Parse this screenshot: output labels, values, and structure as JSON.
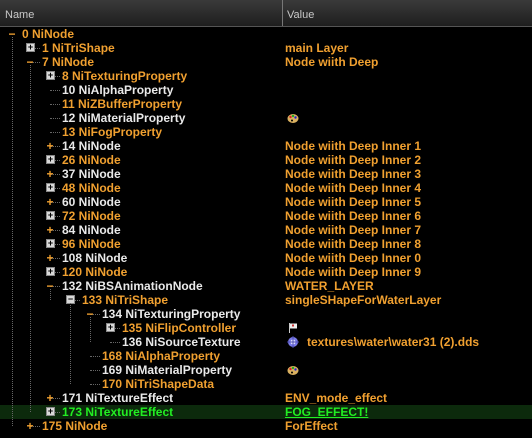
{
  "header": {
    "col_name": "Name",
    "col_value": "Value"
  },
  "rows": [
    {
      "name": "0 NiNode",
      "value": "",
      "expander": "minus",
      "style": "orange"
    },
    {
      "name": "1 NiTriShape",
      "value": "main Layer",
      "expander": "plus-box",
      "style": "orange"
    },
    {
      "name": "7 NiNode",
      "value": "Node wiith Deep",
      "expander": "minus",
      "style": "orange"
    },
    {
      "name": "8 NiTexturingProperty",
      "value": "",
      "expander": "plus-box",
      "style": "orange"
    },
    {
      "name": "10 NiAlphaProperty",
      "value": "",
      "expander": "none",
      "style": "white"
    },
    {
      "name": "11 NiZBufferProperty",
      "value": "",
      "expander": "none",
      "style": "orange"
    },
    {
      "name": "12 NiMaterialProperty",
      "value": "",
      "expander": "none",
      "style": "white",
      "value_icon": "palette-icon"
    },
    {
      "name": "13 NiFogProperty",
      "value": "",
      "expander": "none",
      "style": "orange"
    },
    {
      "name": "14 NiNode",
      "value": "Node wiith Deep Inner 1",
      "expander": "plus",
      "style": "white"
    },
    {
      "name": "26 NiNode",
      "value": "Node wiith Deep Inner 2",
      "expander": "plus-box",
      "style": "orange"
    },
    {
      "name": "37 NiNode",
      "value": "Node wiith Deep Inner 3",
      "expander": "plus",
      "style": "white"
    },
    {
      "name": "48 NiNode",
      "value": "Node wiith Deep Inner 4",
      "expander": "plus-box",
      "style": "orange"
    },
    {
      "name": "60 NiNode",
      "value": "Node wiith Deep Inner 5",
      "expander": "plus",
      "style": "white"
    },
    {
      "name": "72 NiNode",
      "value": "Node wiith Deep Inner 6",
      "expander": "plus-box",
      "style": "orange"
    },
    {
      "name": "84 NiNode",
      "value": "Node wiith Deep Inner 7",
      "expander": "plus",
      "style": "white"
    },
    {
      "name": "96 NiNode",
      "value": "Node wiith Deep Inner 8",
      "expander": "plus-box",
      "style": "orange"
    },
    {
      "name": "108 NiNode",
      "value": "Node wiith Deep Inner 0",
      "expander": "plus",
      "style": "white"
    },
    {
      "name": "120 NiNode",
      "value": "Node wiith Deep Inner 9",
      "expander": "plus-box",
      "style": "orange"
    },
    {
      "name": "132 NiBSAnimationNode",
      "value": "WATER_LAYER",
      "expander": "minus",
      "style": "white"
    },
    {
      "name": "133 NiTriShape",
      "value": "singleSHapeForWaterLayer",
      "expander": "minus-box",
      "style": "orange"
    },
    {
      "name": "134 NiTexturingProperty",
      "value": "",
      "expander": "minus",
      "style": "white"
    },
    {
      "name": "135 NiFlipController",
      "value": "",
      "expander": "plus-box",
      "style": "orange",
      "value_icon": "flag-icon"
    },
    {
      "name": "136 NiSourceTexture",
      "value": "textures\\water\\water31 (2).dds",
      "expander": "none",
      "style": "white",
      "value_icon": "texture-icon"
    },
    {
      "name": "168 NiAlphaProperty",
      "value": "",
      "expander": "none",
      "style": "orange"
    },
    {
      "name": "169 NiMaterialProperty",
      "value": "",
      "expander": "none",
      "style": "white",
      "value_icon": "palette-icon"
    },
    {
      "name": "170 NiTriShapeData",
      "value": "",
      "expander": "none",
      "style": "orange"
    },
    {
      "name": "171 NiTextureEffect",
      "value": "ENV_mode_effect",
      "expander": "plus",
      "style": "white"
    },
    {
      "name": "173 NiTextureEffect",
      "value": "FOG_EFFECT!",
      "expander": "plus-box",
      "style": "green",
      "selected": true
    },
    {
      "name": "175 NiNode",
      "value": "ForEffect",
      "expander": "plus",
      "style": "orange"
    }
  ],
  "colors": {
    "orange": "#f0a030",
    "green": "#22ee22",
    "white": "#e9e9e9",
    "background": "#000000"
  }
}
